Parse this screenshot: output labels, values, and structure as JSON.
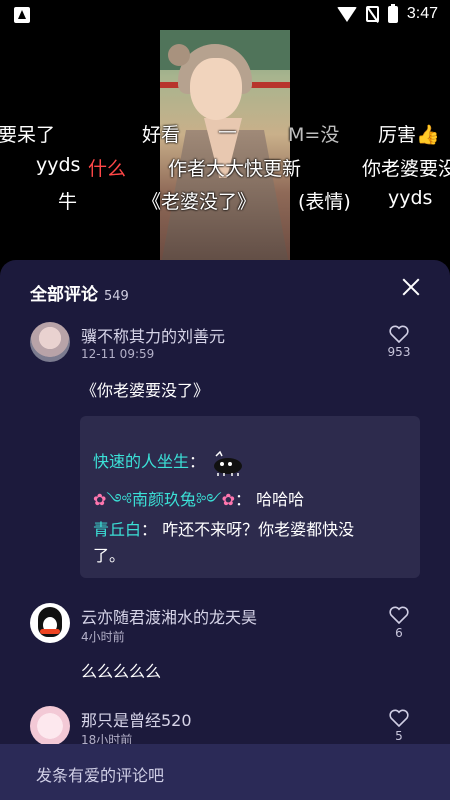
{
  "status_bar": {
    "time": "3:47"
  },
  "danmaku": {
    "row1": [
      "要呆了",
      "好看",
      "—",
      "M=没",
      "厉害👍"
    ],
    "row2": [
      "yyds",
      "什么",
      "作者大大快更新",
      "你老婆要没"
    ],
    "row3": [
      "牛",
      "《老婆没了》",
      "(表情)",
      "yyds"
    ]
  },
  "comments_panel": {
    "title": "全部评论",
    "count": "549",
    "comments": [
      {
        "username": "骥不称其力的刘善元",
        "time": "12-11 09:59",
        "likes": "953",
        "text": "《你老婆要没了》",
        "quote": {
          "line1_name": "快速的人坐生",
          "line1_sep": "：",
          "line2_name": "༺南颜玖兔༻",
          "line2_text": "：  哈哈哈",
          "line3_name": "青丘白",
          "line3_text": "：  咋还不来呀？你老婆都快没",
          "line4_text": "了。"
        }
      },
      {
        "username": "云亦随君渡湘水的龙天昊",
        "time": "4小时前",
        "likes": "6",
        "text": "么么么么么"
      },
      {
        "username": "那只是曾经520",
        "time": "18小时前",
        "likes": "5"
      }
    ]
  },
  "input": {
    "placeholder": "发条有爱的评论吧"
  }
}
